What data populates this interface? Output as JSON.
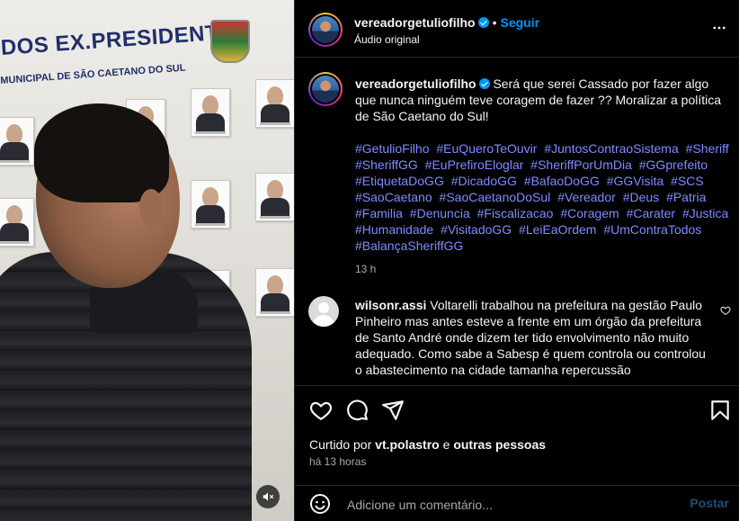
{
  "media": {
    "wall_title": "DOS EX.PRESIDENTES",
    "wall_subtitle": "MUNICIPAL DE SÃO CAETANO DO SUL"
  },
  "header": {
    "username": "vereadorgetuliofilho",
    "separator": "•",
    "follow_label": "Seguir",
    "audio_label": "Áudio original",
    "more_icon": "more-horizontal-icon"
  },
  "caption": {
    "username": "vereadorgetuliofilho",
    "text": "Será que serei Cassado por fazer algo que nunca ninguém teve coragem de fazer ?? Moralizar a política de São Caetano do Sul!",
    "hashtags": [
      "#GetulioFilho",
      "#EuQueroTeOuvir",
      "#JuntosContraoSistema",
      "#Sheriff",
      "#SheriffGG",
      "#EuPrefiroEloglar",
      "#SheriffPorUmDia",
      "#GGprefeito",
      "#EtiquetaDoGG",
      "#DicadoGG",
      "#BafaoDoGG",
      "#GGVisita",
      "#SCS",
      "#SaoCaetano",
      "#SaoCaetanoDoSul",
      "#Vereador",
      "#Deus",
      "#Patria",
      "#Familia",
      "#Denuncia",
      "#Fiscalizacao",
      "#Coragem",
      "#Carater",
      "#Justica",
      "#Humanidade",
      "#VisitadoGG",
      "#LeiEaOrdem",
      "#UmContraTodos",
      "#BalançaSheriffGG"
    ],
    "time": "13 h"
  },
  "comment": {
    "username": "wilsonr.assi",
    "text": "Voltarelli trabalhou na prefeitura na gestão Paulo Pinheiro mas antes esteve a frente em um órgão da prefeitura de Santo André onde dizem ter tido envolvimento não muito adequado. Como sabe a Sabesp é quem controla ou controlou o abastecimento na cidade tamanha repercussão"
  },
  "actions": {
    "liked_prefix": "Curtido por",
    "liked_user": "vt.polastro",
    "liked_joiner": "e",
    "liked_others": "outras pessoas",
    "posted_time": "há 13 horas"
  },
  "add_comment": {
    "placeholder": "Adicione um comentário...",
    "post_label": "Postar"
  },
  "colors": {
    "link": "#0095f6",
    "hashtag": "#7e8cff",
    "secondary_text": "#a8a8a8",
    "background": "#000000"
  }
}
